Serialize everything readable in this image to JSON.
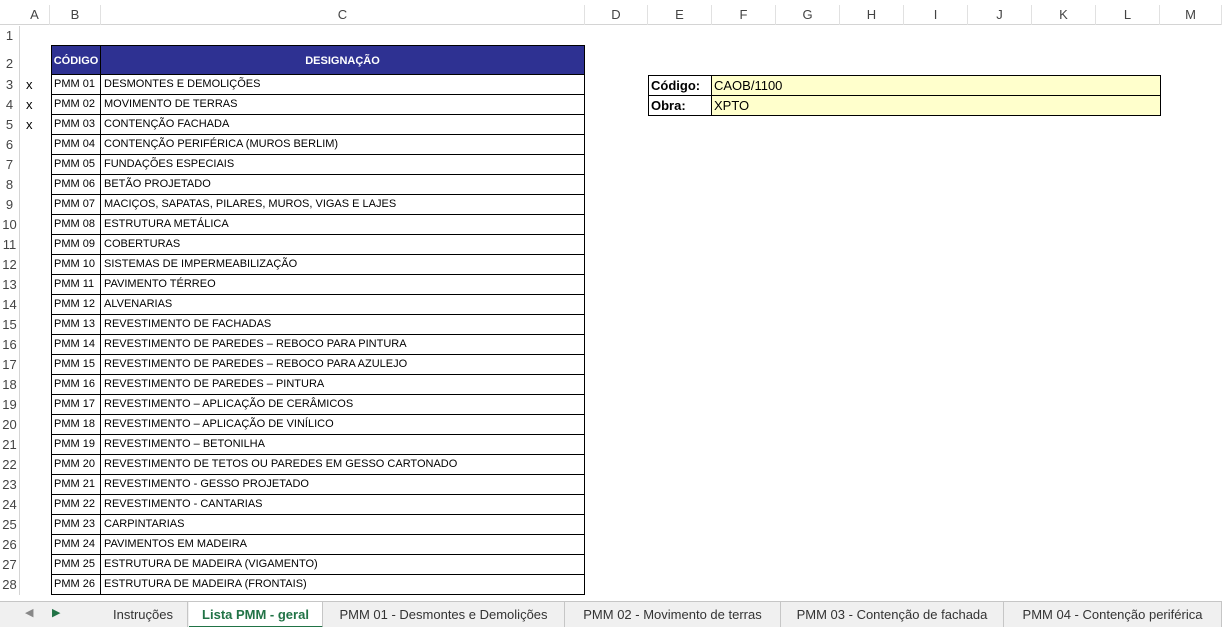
{
  "columns": [
    "A",
    "B",
    "C",
    "D",
    "E",
    "F",
    "G",
    "H",
    "I",
    "J",
    "K",
    "L",
    "M"
  ],
  "rows": [
    "1",
    "2",
    "3",
    "4",
    "5",
    "6",
    "7",
    "8",
    "9",
    "10",
    "11",
    "12",
    "13",
    "14",
    "15",
    "16",
    "17",
    "18",
    "19",
    "20",
    "21",
    "22",
    "23",
    "24",
    "25",
    "26",
    "27",
    "28"
  ],
  "marks": [
    "x",
    "x",
    "x"
  ],
  "table": {
    "header_code": "CÓDIGO",
    "header_designation": "DESIGNAÇÃO",
    "rows": [
      {
        "code": "PMM 01",
        "designation": "DESMONTES E DEMOLIÇÕES"
      },
      {
        "code": "PMM 02",
        "designation": "MOVIMENTO DE TERRAS"
      },
      {
        "code": "PMM 03",
        "designation": "CONTENÇÃO FACHADA"
      },
      {
        "code": "PMM 04",
        "designation": "CONTENÇÃO PERIFÉRICA (MUROS BERLIM)"
      },
      {
        "code": "PMM 05",
        "designation": "FUNDAÇÕES ESPECIAIS"
      },
      {
        "code": "PMM 06",
        "designation": "BETÃO PROJETADO"
      },
      {
        "code": "PMM 07",
        "designation": "MACIÇOS, SAPATAS, PILARES, MUROS, VIGAS E LAJES"
      },
      {
        "code": "PMM 08",
        "designation": "ESTRUTURA METÁLICA"
      },
      {
        "code": "PMM 09",
        "designation": "COBERTURAS"
      },
      {
        "code": "PMM 10",
        "designation": "SISTEMAS DE IMPERMEABILIZAÇÃO"
      },
      {
        "code": "PMM 11",
        "designation": "PAVIMENTO TÉRREO"
      },
      {
        "code": "PMM 12",
        "designation": "ALVENARIAS"
      },
      {
        "code": "PMM 13",
        "designation": "REVESTIMENTO DE FACHADAS"
      },
      {
        "code": "PMM 14",
        "designation": "REVESTIMENTO DE PAREDES – REBOCO PARA PINTURA"
      },
      {
        "code": "PMM 15",
        "designation": "REVESTIMENTO DE PAREDES – REBOCO PARA AZULEJO"
      },
      {
        "code": "PMM 16",
        "designation": "REVESTIMENTO DE PAREDES – PINTURA"
      },
      {
        "code": "PMM 17",
        "designation": "REVESTIMENTO – APLICAÇÃO DE CERÂMICOS"
      },
      {
        "code": "PMM 18",
        "designation": "REVESTIMENTO – APLICAÇÃO DE VINÍLICO"
      },
      {
        "code": "PMM 19",
        "designation": "REVESTIMENTO – BETONILHA"
      },
      {
        "code": "PMM 20",
        "designation": "REVESTIMENTO DE TETOS OU PAREDES EM GESSO CARTONADO"
      },
      {
        "code": "PMM 21",
        "designation": "REVESTIMENTO - GESSO PROJETADO"
      },
      {
        "code": "PMM 22",
        "designation": "REVESTIMENTO - CANTARIAS"
      },
      {
        "code": "PMM 23",
        "designation": "CARPINTARIAS"
      },
      {
        "code": "PMM 24",
        "designation": "PAVIMENTOS EM MADEIRA"
      },
      {
        "code": "PMM 25",
        "designation": "ESTRUTURA DE MADEIRA (VIGAMENTO)"
      },
      {
        "code": "PMM 26",
        "designation": "ESTRUTURA DE MADEIRA (FRONTAIS)"
      }
    ]
  },
  "info": {
    "code_label": "Código:",
    "code_value": "CAOB/1100",
    "work_label": "Obra:",
    "work_value": "XPTO"
  },
  "tabs": [
    {
      "label": "Instruções",
      "active": false
    },
    {
      "label": "Lista PMM - geral",
      "active": true
    },
    {
      "label": "PMM 01 - Desmontes e Demolições",
      "active": false
    },
    {
      "label": "PMM 02 - Movimento de terras",
      "active": false
    },
    {
      "label": "PMM 03 - Contenção de fachada",
      "active": false
    },
    {
      "label": "PMM 04 - Contenção periférica",
      "active": false
    }
  ],
  "nav": {
    "prev_icon": "triangle-left-icon",
    "next_icon": "triangle-right-icon"
  }
}
